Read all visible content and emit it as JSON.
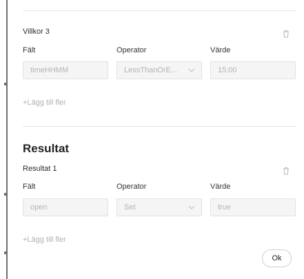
{
  "condition3": {
    "title": "Villkor 3",
    "labels": {
      "field": "Fält",
      "operator": "Operator",
      "value": "Värde"
    },
    "field_value": "timeHHMM",
    "operator_value": "LessThanOrE...",
    "value_value": "15:00",
    "add_more": "+Lägg till fler",
    "delete_icon": "trash-icon"
  },
  "results": {
    "heading": "Resultat",
    "result1": {
      "title": "Resultat 1",
      "labels": {
        "field": "Fält",
        "operator": "Operator",
        "value": "Värde"
      },
      "field_value": "open",
      "operator_value": "Set",
      "value_value": "true",
      "delete_icon": "trash-icon"
    },
    "add_more": "+Lägg till fler"
  },
  "footer": {
    "ok_label": "Ok"
  },
  "colors": {
    "divider": "#e6e6e6",
    "field_bg": "#f5f5f5",
    "muted_text": "#b0b0b0"
  }
}
